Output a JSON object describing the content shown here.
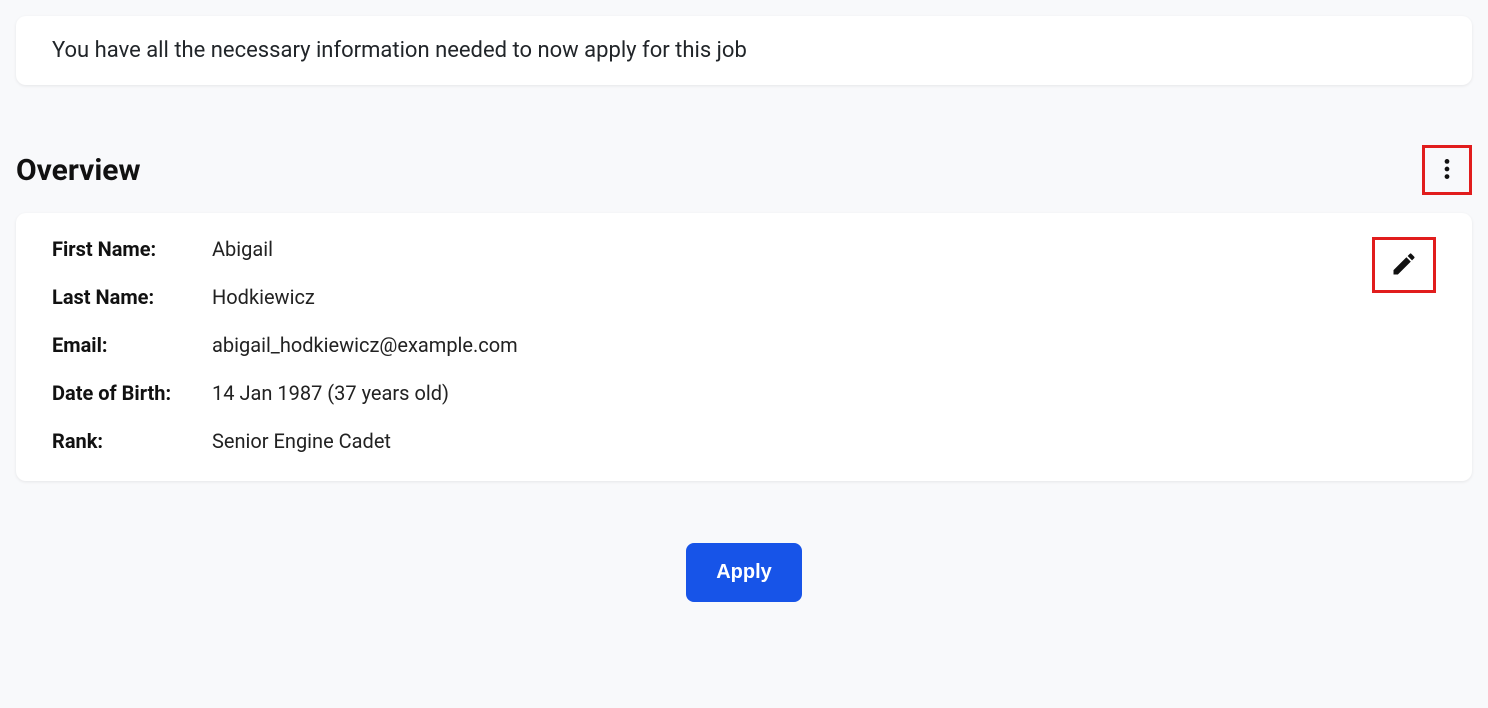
{
  "banner": {
    "message": "You have all the necessary information needed to now apply for this job"
  },
  "section": {
    "title": "Overview"
  },
  "overview": {
    "fields": [
      {
        "label": "First Name:",
        "value": "Abigail"
      },
      {
        "label": "Last Name:",
        "value": "Hodkiewicz"
      },
      {
        "label": "Email:",
        "value": "abigail_hodkiewicz@example.com"
      },
      {
        "label": "Date of Birth:",
        "value": "14 Jan 1987 (37 years old)"
      },
      {
        "label": "Rank:",
        "value": "Senior Engine Cadet"
      }
    ]
  },
  "actions": {
    "apply_label": "Apply"
  }
}
